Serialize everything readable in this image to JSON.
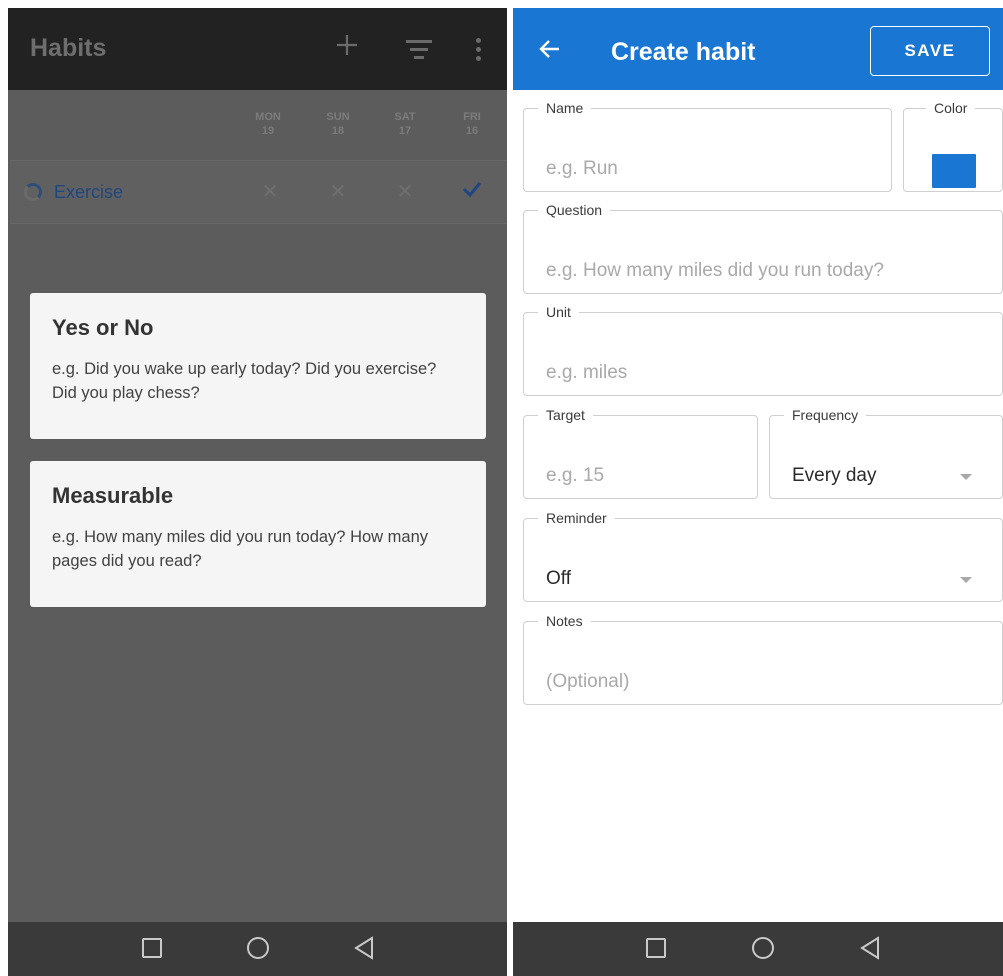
{
  "left": {
    "appbar": {
      "title": "Habits",
      "icons": [
        "plus-icon",
        "filter-icon",
        "more-vert-icon"
      ]
    },
    "days": [
      {
        "name": "MON",
        "num": "19"
      },
      {
        "name": "SUN",
        "num": "18"
      },
      {
        "name": "SAT",
        "num": "17"
      },
      {
        "name": "FRI",
        "num": "16"
      }
    ],
    "habit": {
      "name": "Exercise",
      "marks": [
        "cross",
        "cross",
        "cross",
        "check"
      ]
    },
    "dialog": {
      "options": [
        {
          "title": "Yes or No",
          "desc": "e.g. Did you wake up early today? Did you exercise? Did you play chess?"
        },
        {
          "title": "Measurable",
          "desc": "e.g. How many miles did you run today? How many pages did you read?"
        }
      ]
    }
  },
  "right": {
    "appbar": {
      "title": "Create habit",
      "save_label": "SAVE"
    },
    "form": {
      "name": {
        "label": "Name",
        "placeholder": "e.g. Run"
      },
      "color": {
        "label": "Color",
        "value": "#1976d2"
      },
      "question": {
        "label": "Question",
        "placeholder": "e.g. How many miles did you run today?"
      },
      "unit": {
        "label": "Unit",
        "placeholder": "e.g. miles"
      },
      "target": {
        "label": "Target",
        "placeholder": "e.g. 15"
      },
      "frequency": {
        "label": "Frequency",
        "value": "Every day"
      },
      "reminder": {
        "label": "Reminder",
        "value": "Off"
      },
      "notes": {
        "label": "Notes",
        "placeholder": "(Optional)"
      }
    }
  },
  "navbar": {
    "icons": [
      "recents-square-icon",
      "home-circle-icon",
      "back-triangle-icon"
    ]
  },
  "colors": {
    "appbar_blue": "#1976d2",
    "habit_blue": "#1e4680",
    "scrim_gray": "#5c5c5c"
  }
}
